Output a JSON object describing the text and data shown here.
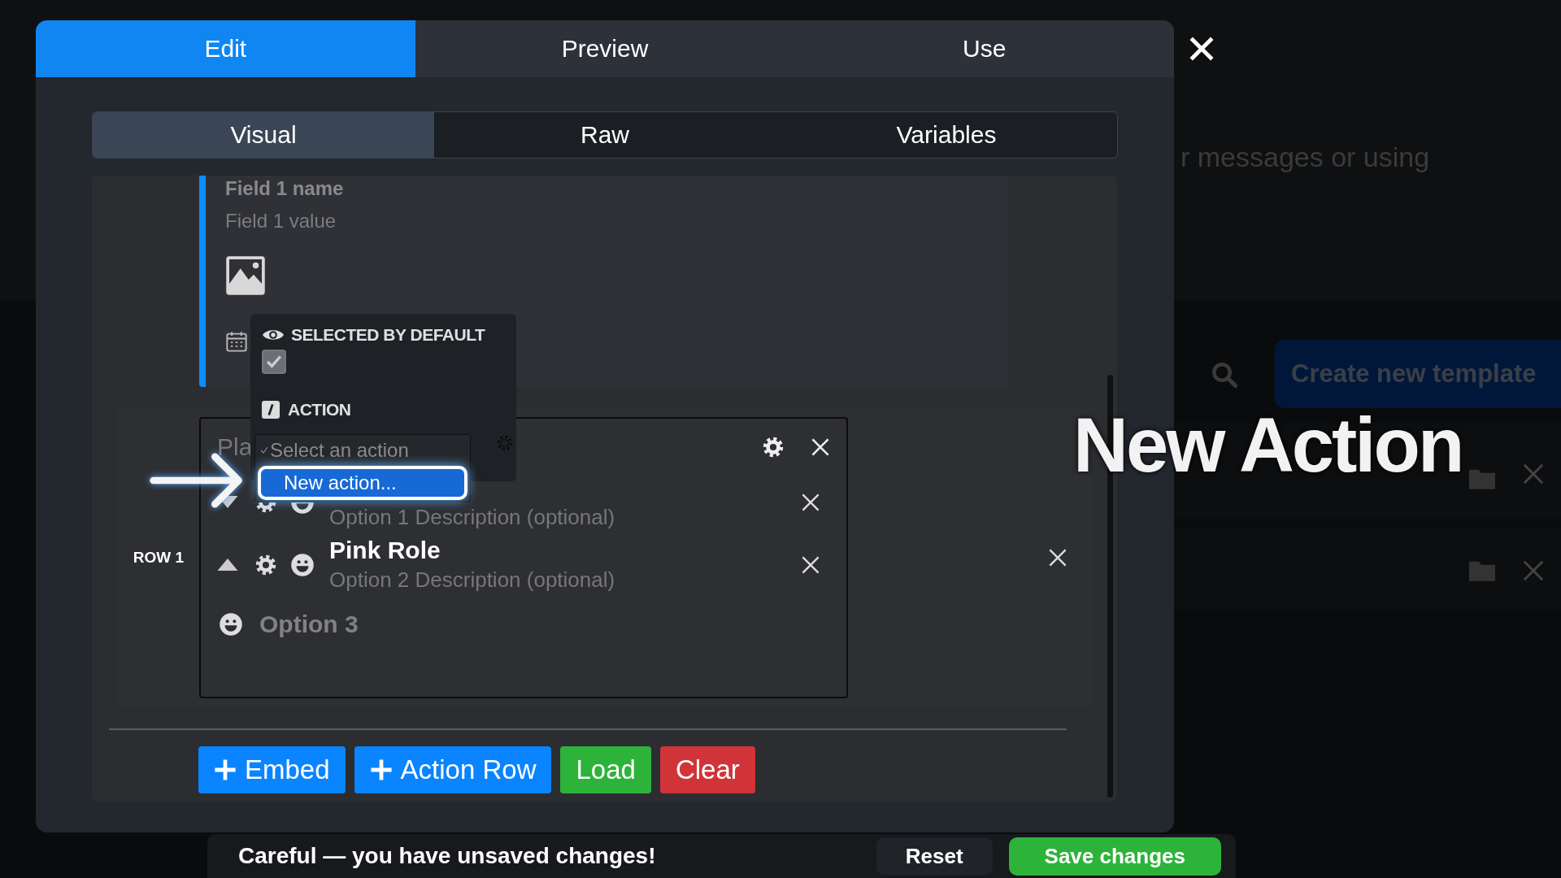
{
  "top_tabs": [
    {
      "label": "Edit",
      "selected": true
    },
    {
      "label": "Preview",
      "selected": false
    },
    {
      "label": "Use",
      "selected": false
    }
  ],
  "editor_tabs": [
    {
      "label": "Visual",
      "selected": true
    },
    {
      "label": "Raw",
      "selected": false
    },
    {
      "label": "Variables",
      "selected": false
    }
  ],
  "embed": {
    "field_name": "Field 1 name",
    "field_value": "Field 1 value"
  },
  "option_popup": {
    "default_label": "SELECTED BY DEFAULT",
    "selected_by_default": true,
    "action_label": "ACTION"
  },
  "action_dropdown": [
    {
      "label": "Select an action",
      "checked": true,
      "highlighted": false
    },
    {
      "label": "New action...",
      "checked": false,
      "highlighted": true
    }
  ],
  "action_row": {
    "label": "ROW 1",
    "placeholder": "Pla",
    "options": [
      {
        "kind": "role",
        "moves_up": false,
        "description": "Option 1 Description (optional)"
      },
      {
        "kind": "role",
        "moves_up": true,
        "title": "Pink Role",
        "description": "Option 2 Description (optional)"
      },
      {
        "kind": "add",
        "label": "Option 3"
      }
    ]
  },
  "buttons": [
    {
      "label": "Embed",
      "kind": "primary",
      "plus": true
    },
    {
      "label": "Action Row",
      "kind": "primary",
      "plus": true
    },
    {
      "label": "Load",
      "kind": "success",
      "plus": false
    },
    {
      "label": "Clear",
      "kind": "danger",
      "plus": false
    }
  ],
  "caption": "New Action",
  "background": {
    "hint_text": "r messages or using",
    "create_button": "Create new template"
  },
  "unsaved_bar": {
    "message": "Careful — you have unsaved changes!",
    "reset": "Reset",
    "save": "Save changes"
  }
}
